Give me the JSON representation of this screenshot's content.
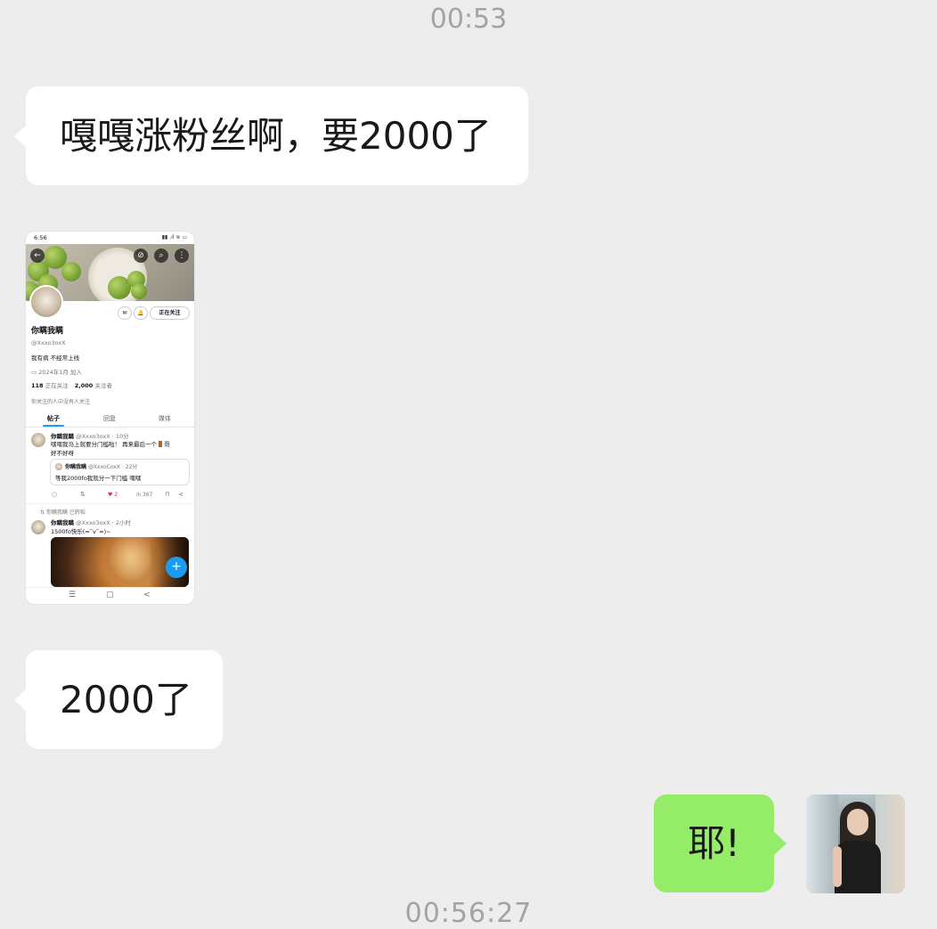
{
  "timestamps": {
    "top": "00:53",
    "bottom": "00:56:27"
  },
  "messages": [
    {
      "side": "incoming",
      "text": "嘎嘎涨粉丝啊，要2000了"
    },
    {
      "side": "incoming",
      "type": "image"
    },
    {
      "side": "incoming",
      "text": "2000了"
    },
    {
      "side": "outgoing",
      "text": "耶!"
    }
  ],
  "colors": {
    "background": "#ededed",
    "incoming_bubble": "#ffffff",
    "outgoing_bubble": "#95ec69",
    "twitter_blue": "#1d9bf0"
  },
  "screenshot": {
    "status_time": "6:56",
    "status_icons": "▮▮ .ıl ≋ ▭",
    "banner_icons": [
      "←",
      "⊘",
      "⌕",
      "⋮"
    ],
    "action_icons": [
      "✉",
      "🔔"
    ],
    "following_button": "正在关注",
    "display_name": "你瞒我瞒",
    "handle": "@Xxxo3oxX",
    "bio": "我有病 不经常上线",
    "joined": "2024年1月 加入",
    "following_count": "118",
    "following_label": "正在关注",
    "followers_count": "2,000",
    "followers_label": "关注者",
    "mutuals": "你关注的人中没有人关注",
    "tabs": [
      "帖子",
      "回复",
      "媒体"
    ],
    "post1": {
      "name": "你瞒我瞒",
      "meta": "@Xxxo3oxX · 10分",
      "line1": "嘿嘿我马上就要分门槛啦！ 再来最后一个",
      "line1_end": "哥",
      "line2": "好不好呀",
      "quote_name": "你瞒我瞒",
      "quote_meta": "@XxxoCoxX · 22分",
      "quote_text": "等我2000fo我就分一下门槛 嘿嘿",
      "likes": "2",
      "views": "367"
    },
    "retweet_label": "你瞒我瞒 已转帖",
    "post2": {
      "name": "你瞒我瞒",
      "meta": "@Xxxo3oxX · 2小时",
      "text": "1500fo快乐(=˘v˘=)~"
    },
    "fab_icon": "+",
    "nav_icons": [
      "☰",
      "▢",
      "<"
    ]
  }
}
